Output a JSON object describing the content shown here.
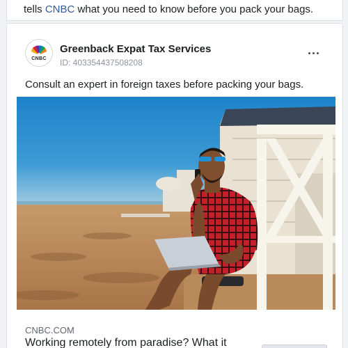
{
  "feed": {
    "prev_post_text_before": "tells ",
    "prev_post_link": "CNBC",
    "prev_post_text_after": " what you need to know before you pack your bags."
  },
  "ad": {
    "advertiser_name": "Greenback Expat Tax Services",
    "ad_id": "ID: 403354437508208",
    "avatar_label": "CNBC",
    "more_icon": "more-horizontal-icon",
    "body_text": "Consult an expert in foreign taxes before packing your bags.",
    "image_subject": "man-on-beach-with-laptop-photo",
    "link_domain": "CNBC.COM",
    "link_headline": "Working remotely from paradise? What it"
  },
  "colors": {
    "link": "#385898",
    "background": "#f0f2f5",
    "card": "#ffffff"
  }
}
